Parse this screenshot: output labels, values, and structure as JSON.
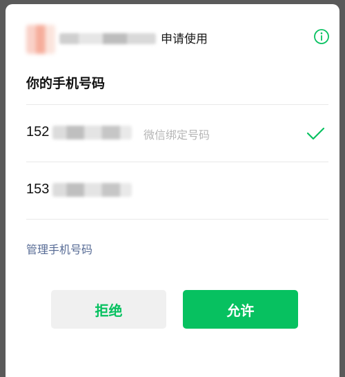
{
  "header": {
    "title": "申请使用",
    "info_icon": "info-circle-icon"
  },
  "section": {
    "title": "你的手机号码"
  },
  "phones": [
    {
      "prefix": "152",
      "tag": "微信绑定号码",
      "selected": true
    },
    {
      "prefix": "153",
      "tag": "",
      "selected": false
    }
  ],
  "manage_link": "管理手机号码",
  "buttons": {
    "deny": "拒绝",
    "allow": "允许"
  },
  "colors": {
    "accent": "#07c160",
    "link": "#576b95",
    "deny_bg": "#f0f0f0"
  }
}
